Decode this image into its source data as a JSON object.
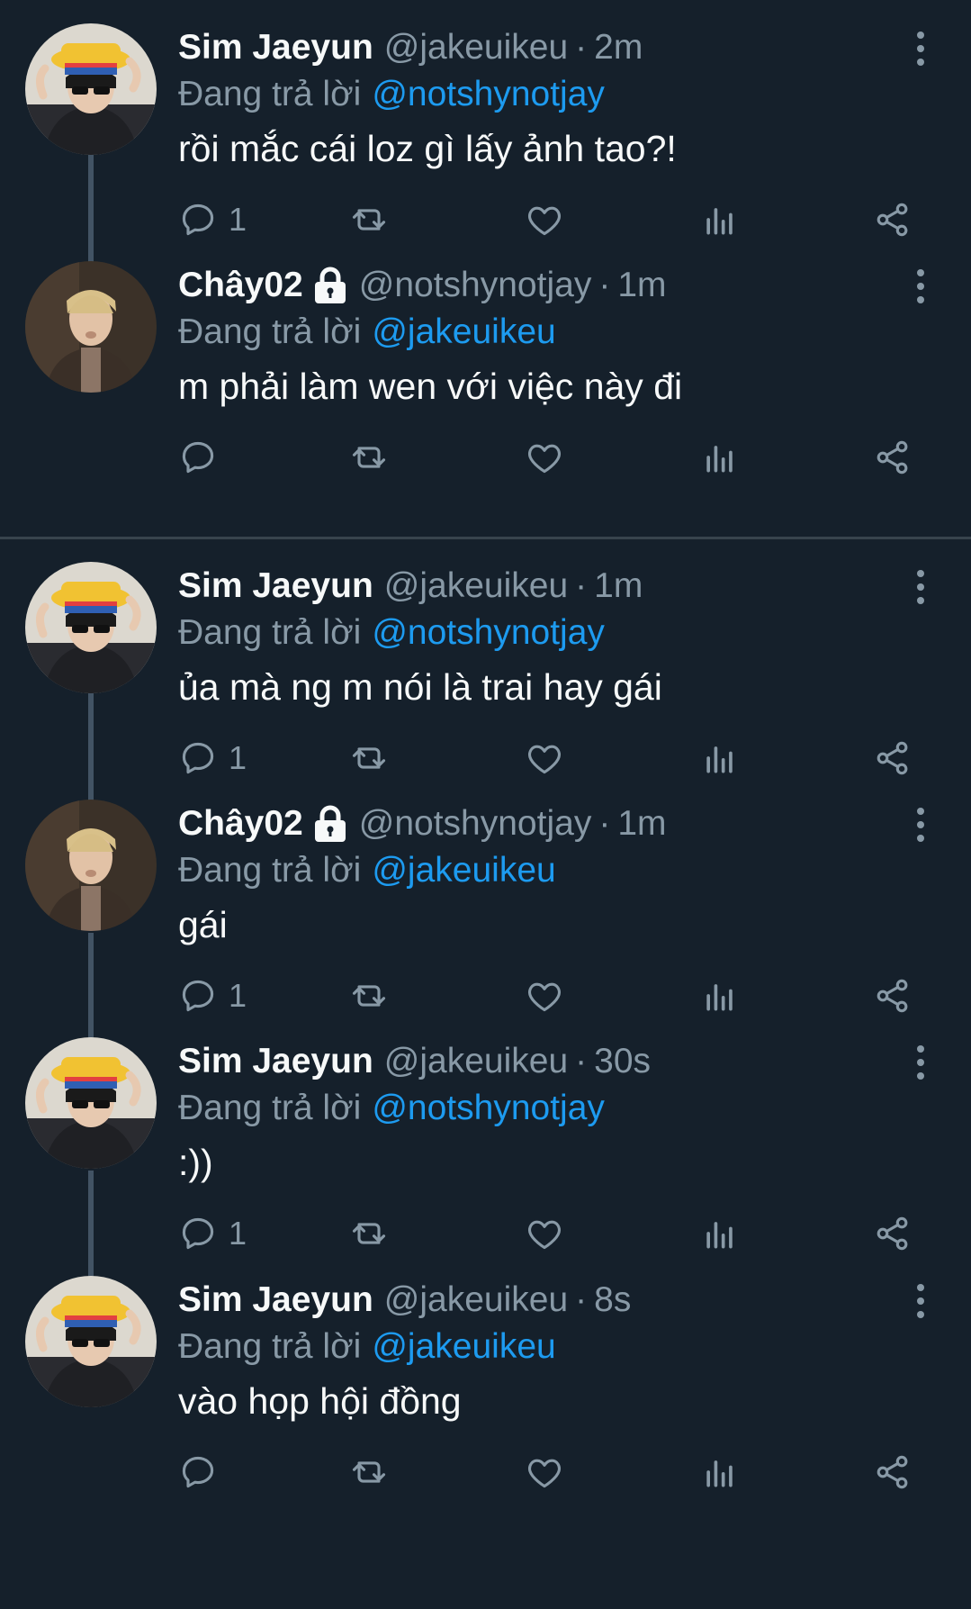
{
  "colors": {
    "background": "#15202b",
    "mention": "#1d9bf0",
    "muted": "#8899a6",
    "line": "#425364"
  },
  "icons": {
    "reply": "reply-icon",
    "retweet": "retweet-icon",
    "like": "heart-icon",
    "views": "bar-chart-icon",
    "share": "share-icon",
    "more": "more-vertical-icon",
    "lock": "lock-icon"
  },
  "tweets": [
    {
      "name": "Sim Jaeyun",
      "handle": "@jakeuikeu",
      "sep": "·",
      "time": "2m",
      "replying_label": "Đang trả lời",
      "replying_to": "@notshynotjay",
      "text": "rồi mắc cái loz gì lấy ảnh tao?!",
      "reply_count": "1"
    },
    {
      "name": "Chây02",
      "handle": "@notshynotjay",
      "sep": "·",
      "time": "1m",
      "replying_label": "Đang trả lời",
      "replying_to": "@jakeuikeu",
      "text": "m phải làm wen với việc này đi",
      "reply_count": ""
    },
    {
      "name": "Sim Jaeyun",
      "handle": "@jakeuikeu",
      "sep": "·",
      "time": "1m",
      "replying_label": "Đang trả lời",
      "replying_to": "@notshynotjay",
      "text": "ủa mà ng m nói là trai hay gái",
      "reply_count": "1"
    },
    {
      "name": "Chây02",
      "handle": "@notshynotjay",
      "sep": "·",
      "time": "1m",
      "replying_label": "Đang trả lời",
      "replying_to": "@jakeuikeu",
      "text": "gái",
      "reply_count": "1"
    },
    {
      "name": "Sim Jaeyun",
      "handle": "@jakeuikeu",
      "sep": "·",
      "time": "30s",
      "replying_label": "Đang trả lời",
      "replying_to": "@notshynotjay",
      "text": ":))",
      "reply_count": "1"
    },
    {
      "name": "Sim Jaeyun",
      "handle": "@jakeuikeu",
      "sep": "·",
      "time": "8s",
      "replying_label": "Đang trả lời",
      "replying_to": "@jakeuikeu",
      "text": "vào họp hội đồng",
      "reply_count": ""
    }
  ]
}
